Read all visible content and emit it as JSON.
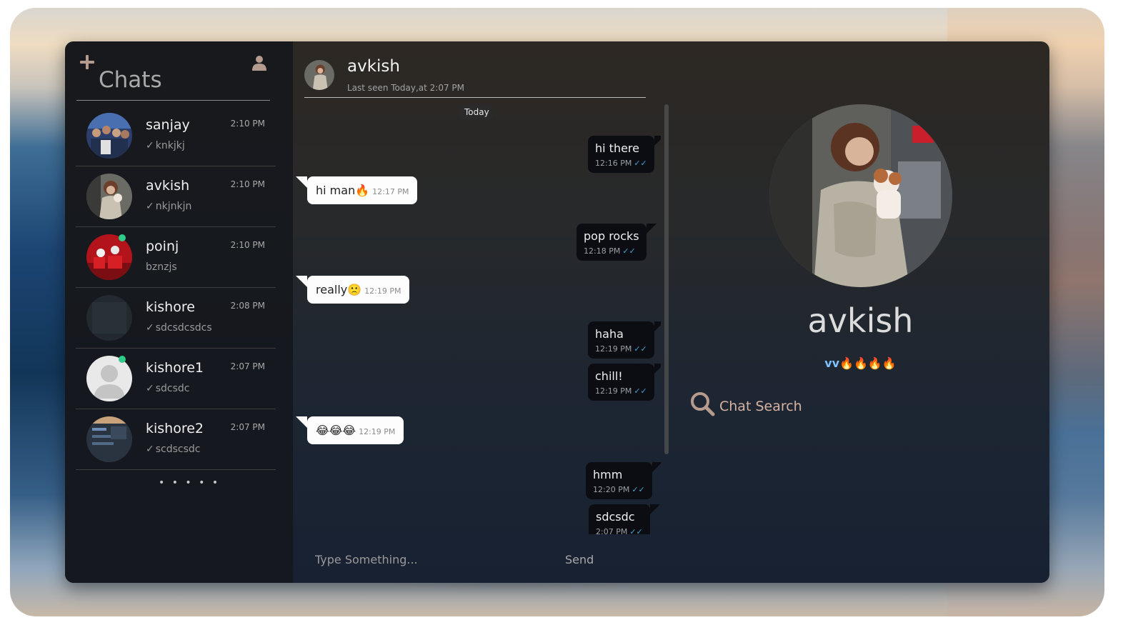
{
  "sidebar": {
    "title": "Chats",
    "more": "• • • • •",
    "items": [
      {
        "name": "sanjay",
        "time": "2:10 PM",
        "preview": "knkjkj",
        "check": "✓",
        "online": false
      },
      {
        "name": "avkish",
        "time": "2:10 PM",
        "preview": "nkjnkjn",
        "check": "✓",
        "online": false
      },
      {
        "name": "poinj",
        "time": "2:10 PM",
        "preview": "bznzjs",
        "check": "",
        "online": true
      },
      {
        "name": "kishore",
        "time": "2:08 PM",
        "preview": "sdcsdcsdcs",
        "check": "✓",
        "online": false
      },
      {
        "name": "kishore1",
        "time": "2:07 PM",
        "preview": "sdcsdc",
        "check": "✓",
        "online": true
      },
      {
        "name": "kishore2",
        "time": "2:07 PM",
        "preview": "scdscsdc",
        "check": "✓",
        "online": false
      }
    ]
  },
  "chat": {
    "name": "avkish",
    "status": "Last seen Today,at 2:07 PM",
    "date_badge": "Today",
    "input_placeholder": "Type Something...",
    "send_label": "Send",
    "messages": [
      {
        "dir": "out",
        "text": "hi there",
        "time": "12:16 PM",
        "ticks": "✓✓"
      },
      {
        "dir": "in",
        "text": "hi man🔥",
        "time": "12:17 PM"
      },
      {
        "dir": "out",
        "text": "pop rocks",
        "time": "12:18 PM",
        "ticks": "✓✓"
      },
      {
        "dir": "in",
        "text": "really🙁",
        "time": "12:19 PM"
      },
      {
        "dir": "out",
        "text": "haha",
        "time": "12:19 PM",
        "ticks": "✓✓"
      },
      {
        "dir": "out",
        "text": "chill!",
        "time": "12:19 PM",
        "ticks": "✓✓"
      },
      {
        "dir": "in",
        "text": "😂😂😂",
        "time": "12:19 PM"
      },
      {
        "dir": "out",
        "text": "hmm",
        "time": "12:20 PM",
        "ticks": "✓✓"
      },
      {
        "dir": "out",
        "text": "sdcsdc",
        "time": "2:07 PM",
        "ticks": "✓✓"
      }
    ]
  },
  "profile": {
    "name": "avkish",
    "status_text": "vv",
    "status_emoji": "🔥🔥🔥🔥",
    "search_label": "Chat Search"
  },
  "colors": {
    "online": "#2ecc8b",
    "read_ticks": "#41a3d4",
    "accent_icon": "#b59a8e",
    "search_label": "#d6b3a2"
  },
  "icons": {
    "new_chat": "plus-icon",
    "profile": "user-icon",
    "search": "search-icon"
  }
}
